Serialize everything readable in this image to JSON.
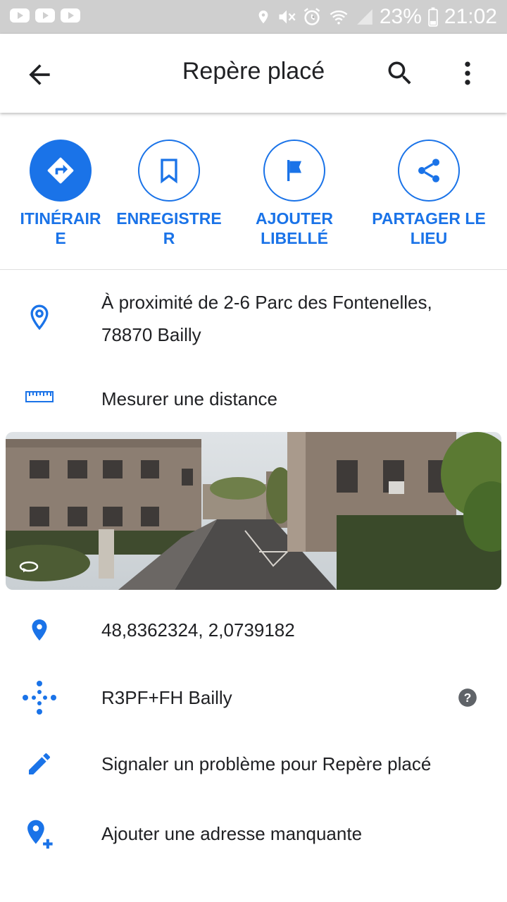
{
  "status_bar": {
    "battery": "23%",
    "time": "21:02"
  },
  "header": {
    "title": "Repère placé"
  },
  "actions": [
    {
      "label": "ITINÉRAIR\nE",
      "icon": "directions-icon"
    },
    {
      "label": "ENREGISTRE\nR",
      "icon": "bookmark-icon"
    },
    {
      "label": "AJOUTER\nLIBELLÉ",
      "icon": "flag-icon"
    },
    {
      "label": "PARTAGER LE\nLIEU",
      "icon": "share-icon"
    }
  ],
  "address": {
    "line1": "À proximité de 2-6 Parc des Fontenelles,",
    "line2": "78870 Bailly"
  },
  "measure": "Mesurer une distance",
  "coordinates": "48,8362324, 2,0739182",
  "plus_code": "R3PF+FH Bailly",
  "report": "Signaler un problème pour Repère placé",
  "add_address": "Ajouter une adresse manquante",
  "colors": {
    "accent": "#1a73e8",
    "status_bar": "#cfcfcf"
  }
}
